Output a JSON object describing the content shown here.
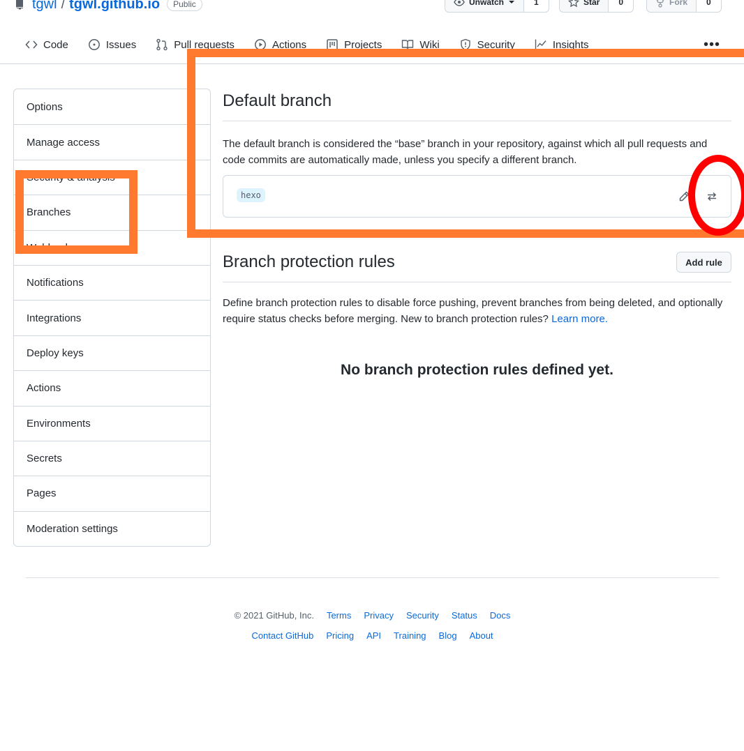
{
  "repo": {
    "owner": "tgwl",
    "name": "tgwl.github.io",
    "visibility": "Public"
  },
  "actions": {
    "watch": {
      "label": "Unwatch",
      "count": "1"
    },
    "star": {
      "label": "Star",
      "count": "0"
    },
    "fork": {
      "label": "Fork",
      "count": "0"
    }
  },
  "nav": {
    "tabs": [
      {
        "label": "Code",
        "icon": "code-icon"
      },
      {
        "label": "Issues",
        "icon": "issue-icon"
      },
      {
        "label": "Pull requests",
        "icon": "pull-request-icon"
      },
      {
        "label": "Actions",
        "icon": "play-icon"
      },
      {
        "label": "Projects",
        "icon": "project-icon"
      },
      {
        "label": "Wiki",
        "icon": "book-icon"
      },
      {
        "label": "Security",
        "icon": "shield-icon"
      },
      {
        "label": "Insights",
        "icon": "graph-icon"
      }
    ],
    "more": "•••"
  },
  "sidebar": {
    "items": [
      {
        "label": "Options"
      },
      {
        "label": "Manage access"
      },
      {
        "label": "Security & analysis"
      },
      {
        "label": "Branches"
      },
      {
        "label": "Webhooks"
      },
      {
        "label": "Notifications"
      },
      {
        "label": "Integrations"
      },
      {
        "label": "Deploy keys"
      },
      {
        "label": "Actions"
      },
      {
        "label": "Environments"
      },
      {
        "label": "Secrets"
      },
      {
        "label": "Pages"
      },
      {
        "label": "Moderation settings"
      }
    ]
  },
  "default_branch": {
    "title": "Default branch",
    "description": "The default branch is considered the “base” branch in your repository, against which all pull requests and code commits are automatically made, unless you specify a different branch.",
    "branch": "hexo"
  },
  "protection": {
    "title": "Branch protection rules",
    "add_rule": "Add rule",
    "description": "Define branch protection rules to disable force pushing, prevent branches from being deleted, and optionally require status checks before merging. New to branch protection rules?",
    "learn_more": "Learn more.",
    "empty": "No branch protection rules defined yet."
  },
  "footer": {
    "copyright": "© 2021 GitHub, Inc.",
    "row1": [
      "Terms",
      "Privacy",
      "Security",
      "Status",
      "Docs"
    ],
    "row2": [
      "Contact GitHub",
      "Pricing",
      "API",
      "Training",
      "Blog",
      "About"
    ]
  },
  "colors": {
    "link": "#0969da",
    "annotation_orange": "#ff7a2e",
    "annotation_red": "#ff0000"
  }
}
